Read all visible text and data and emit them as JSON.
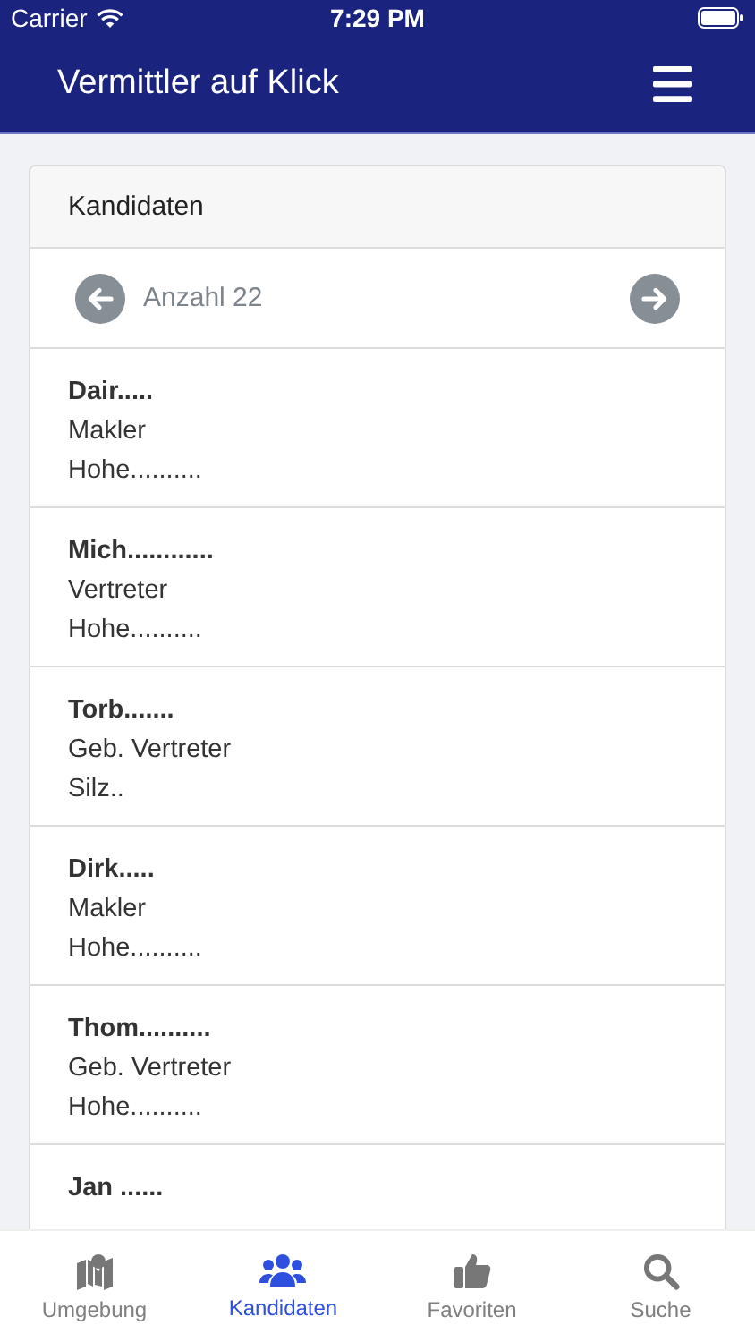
{
  "status_bar": {
    "carrier": "Carrier",
    "time": "7:29 PM"
  },
  "header": {
    "title": "Vermittler auf Klick"
  },
  "card": {
    "title": "Kandidaten",
    "count": "Anzahl 22"
  },
  "candidates": [
    {
      "name": "Dair.....",
      "role": "Makler",
      "place": "Hohe.........."
    },
    {
      "name": "Mich............",
      "role": "Vertreter",
      "place": "Hohe.........."
    },
    {
      "name": "Torb.......",
      "role": "Geb. Vertreter",
      "place": "Silz.."
    },
    {
      "name": "Dirk.....",
      "role": "Makler",
      "place": "Hohe.........."
    },
    {
      "name": "Thom..........",
      "role": "Geb. Vertreter",
      "place": "Hohe.........."
    },
    {
      "name": "Jan ......"
    }
  ],
  "tabs": [
    {
      "kind": "map",
      "label": "Umgebung",
      "selected": false
    },
    {
      "kind": "people",
      "label": "Kandidaten",
      "selected": true
    },
    {
      "kind": "thumb",
      "label": "Favoriten",
      "selected": false
    },
    {
      "kind": "search",
      "label": "Suche",
      "selected": false
    }
  ]
}
